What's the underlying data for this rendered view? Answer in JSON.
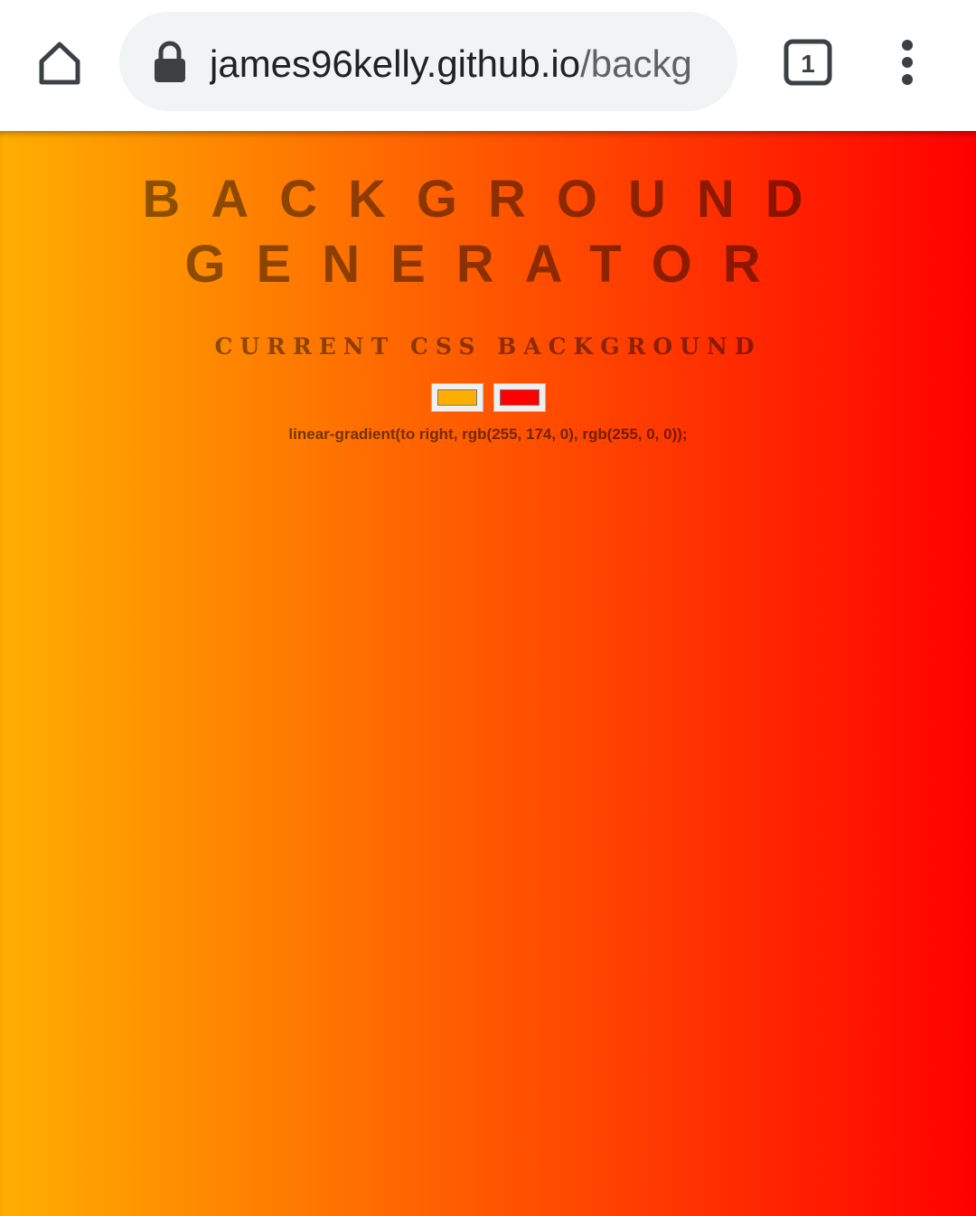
{
  "browser": {
    "url_host": "james96kelly.github.io",
    "url_path": "/backg",
    "tab_count": "1",
    "icons": {
      "home": "home-icon",
      "lock": "lock-icon",
      "tabs": "tab-switcher-icon",
      "menu": "kebab-menu-icon"
    }
  },
  "page": {
    "title_line1": "BACKGROUND",
    "title_line2": "GENERATOR",
    "subtitle": "CURRENT CSS BACKGROUND",
    "color1": "#ffae00",
    "color2": "#ff0000",
    "css_output": "linear-gradient(to right, rgb(255, 174, 0), rgb(255, 0, 0));"
  }
}
